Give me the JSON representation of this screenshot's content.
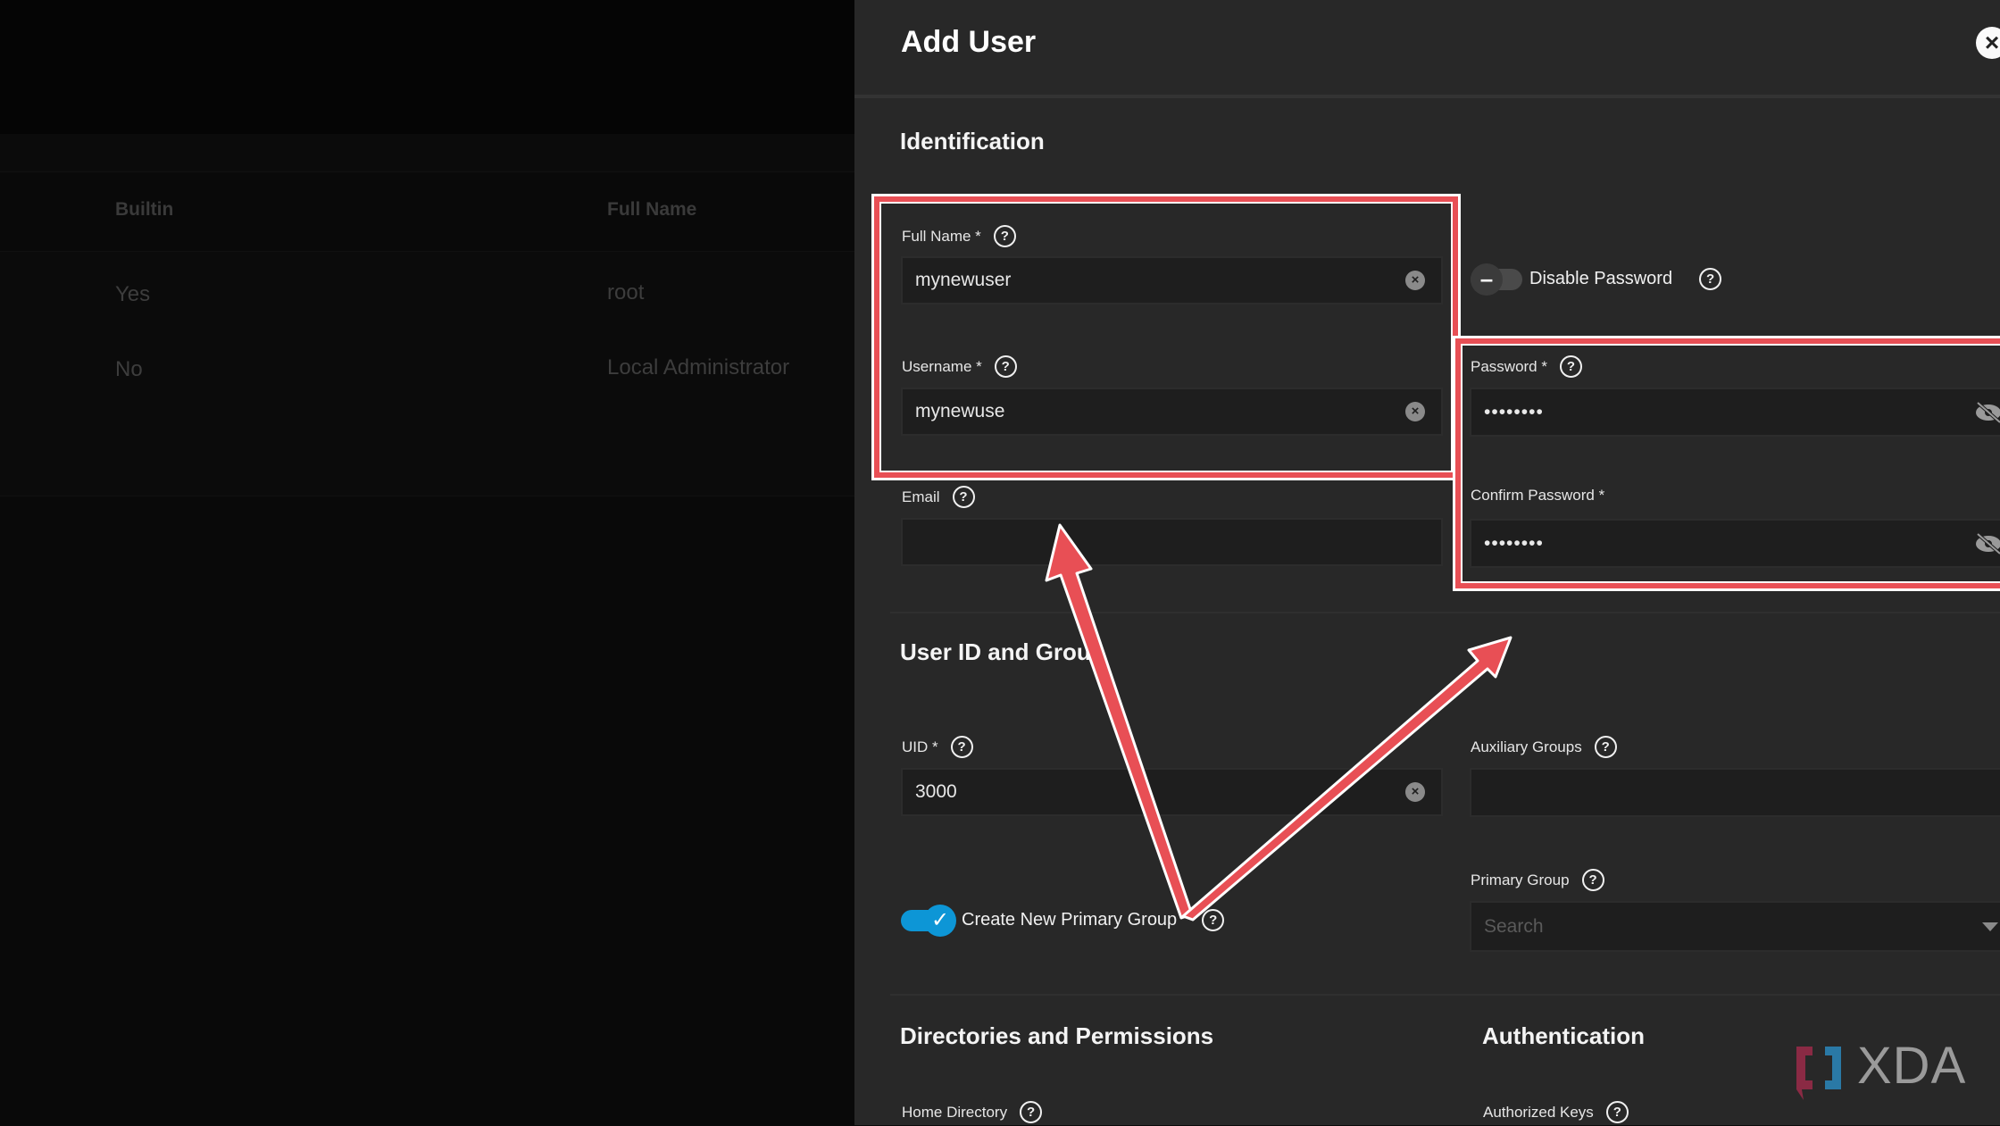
{
  "background_table": {
    "columns": [
      "Builtin",
      "Full Name"
    ],
    "rows": [
      {
        "builtin": "Yes",
        "full_name": "root"
      },
      {
        "builtin": "No",
        "full_name": "Local Administrator"
      }
    ]
  },
  "panel": {
    "title": "Add User",
    "close_icon": "close-icon",
    "sections": {
      "identification": "Identification",
      "user_id_group": "User ID and Group",
      "directories": "Directories and Permissions",
      "authentication": "Authentication"
    },
    "fields": {
      "full_name": {
        "label": "Full Name *",
        "value": "mynewuser"
      },
      "username": {
        "label": "Username *",
        "value": "mynewuse"
      },
      "email": {
        "label": "Email",
        "value": ""
      },
      "disable_password": {
        "label": "Disable Password",
        "checked": false
      },
      "password": {
        "label": "Password *",
        "value": "••••••••"
      },
      "confirm_password": {
        "label": "Confirm Password *",
        "value": "••••••••"
      },
      "uid": {
        "label": "UID *",
        "value": "3000"
      },
      "create_primary_group": {
        "label": "Create New Primary Group",
        "checked": true
      },
      "auxiliary_groups": {
        "label": "Auxiliary Groups",
        "value": ""
      },
      "primary_group": {
        "label": "Primary Group",
        "placeholder": "Search"
      },
      "home_directory": {
        "label": "Home Directory"
      },
      "authorized_keys": {
        "label": "Authorized Keys"
      }
    }
  },
  "annotation": {
    "highlight_color": "#e84f55",
    "accent_color": "#0d96d6"
  },
  "watermark": {
    "text": "XDA"
  }
}
